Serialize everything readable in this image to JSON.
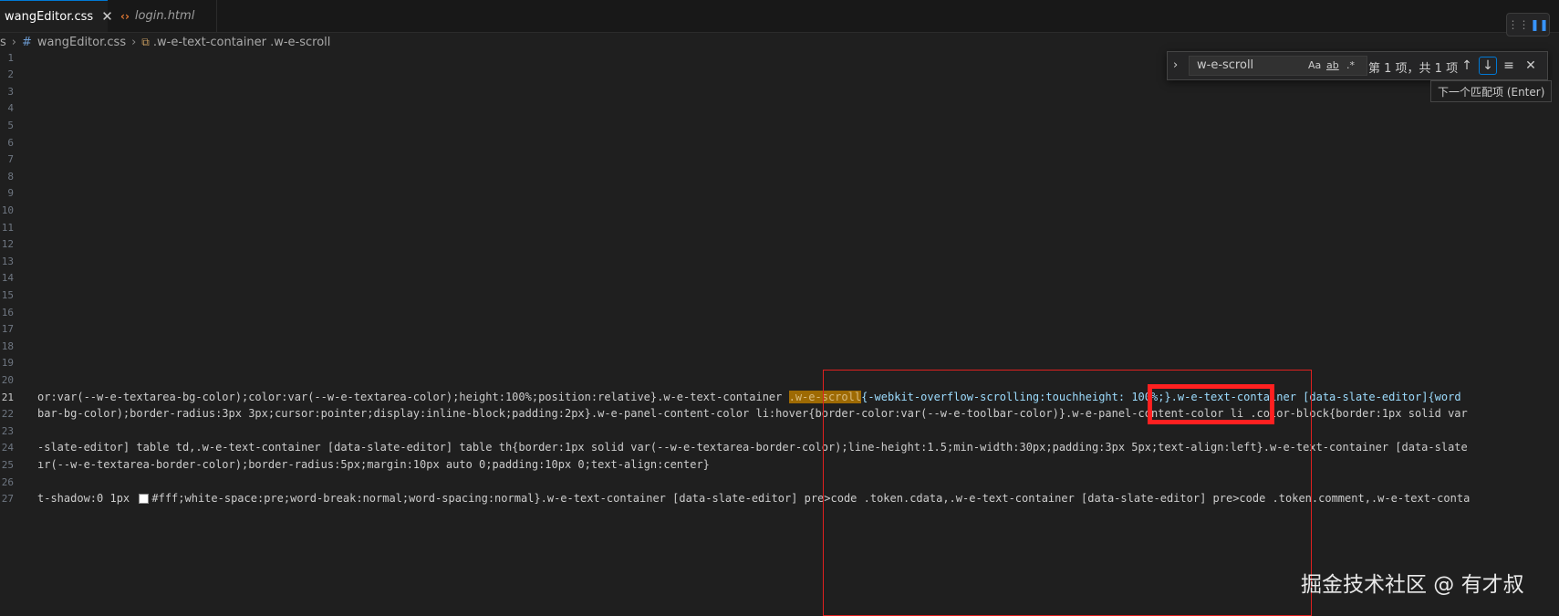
{
  "tabs": {
    "active": {
      "label": "wangEditor.css",
      "close": "✕"
    },
    "inactive": {
      "icon": "‹›",
      "label": "login.html"
    }
  },
  "breadcrumb": {
    "prefix": "s",
    "file": "wangEditor.css",
    "symbol": ".w-e-text-container .w-e-scroll"
  },
  "gutter": {
    "lines": [
      "1",
      "2",
      "3",
      "4",
      "5",
      "6",
      "7",
      "8",
      "9",
      "10",
      "11",
      "12",
      "13",
      "14",
      "15",
      "16",
      "17",
      "18",
      "19",
      "20",
      "21",
      "22",
      "23",
      "24",
      "25",
      "26",
      "27"
    ],
    "current": "21"
  },
  "find_widget": {
    "query": "w-e-scroll",
    "match_case": "Aa",
    "whole_word": "ab",
    "regex": ".*",
    "result_count": "第 1 项，共 1 项",
    "prev_icon": "↑",
    "next_icon": "↓",
    "selection_icon": "≡",
    "close_icon": "✕",
    "tooltip": "下一个匹配项 (Enter)"
  },
  "code": {
    "l21": {
      "a": "or:var(--w-e-textarea-bg-color);color:var(--w-e-textarea-color);height:100%;position:relative}.w-e-text-container ",
      "b": ".w-e-scroll",
      "c": "{-webkit-overflow-scrolling:touch",
      "d": "height: 100%;}.w-e-text-container [data-slate-editor]{word"
    },
    "l22": "bar-bg-color);border-radius:3px 3px;cursor:pointer;display:inline-block;padding:2px}.w-e-panel-content-color li:hover{border-color:var(--w-e-toolbar-color)}.w-e-panel-content-color li .color-block{border:1px solid var",
    "l24": "-slate-editor] table td,.w-e-text-container [data-slate-editor] table th{border:1px solid var(--w-e-textarea-border-color);line-height:1.5;min-width:30px;padding:3px 5px;text-align:left}.w-e-text-container [data-slate",
    "l25": "ır(--w-e-textarea-border-color);border-radius:5px;margin:10px auto 0;padding:10px 0;text-align:center}",
    "l27": {
      "a": "t-shadow:0 1px ",
      "b": "#fff;white-space:pre;word-break:normal;word-spacing:normal}.w-e-text-container [data-slate-editor] pre>code .token.cdata,.w-e-text-container [data-slate-editor] pre>code .token.comment,.w-e-text-conta"
    }
  },
  "watermark": "掘金技术社区 @ 有才叔",
  "colors": {
    "accent": "#0078d4",
    "annotation_red": "#ff2020",
    "match_highlight": "#9e6a03"
  }
}
